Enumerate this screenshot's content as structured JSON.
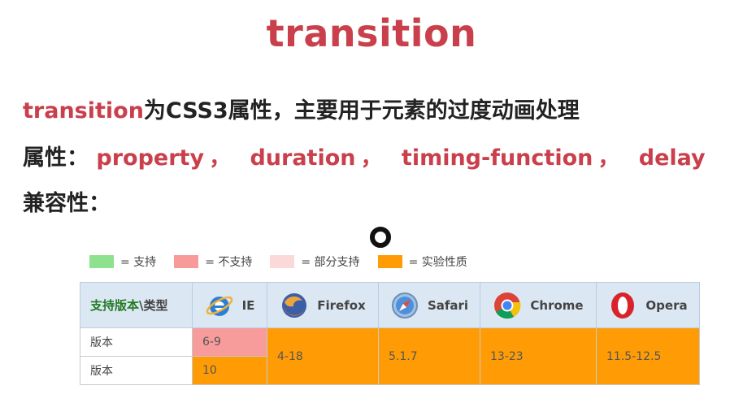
{
  "title": "transition",
  "line1": {
    "keyword": "transition",
    "rest": "为CSS3属性，主要用于元素的过度动画处理"
  },
  "line2": {
    "label": "属性：",
    "props": [
      "property",
      "duration",
      "timing-function",
      "delay"
    ],
    "separator": "，"
  },
  "line3": {
    "label": "兼容性："
  },
  "legend": [
    {
      "label": "= 支持",
      "color": "#8ee28e"
    },
    {
      "label": "= 不支持",
      "color": "#f69a9a"
    },
    {
      "label": "= 部分支持",
      "color": "#fbd9d9"
    },
    {
      "label": "= 实验性质",
      "color": "#ff9c05"
    }
  ],
  "table": {
    "corner": {
      "a": "支持版本",
      "sep": "\\",
      "b": "类型"
    },
    "browsers": [
      "IE",
      "Firefox",
      "Safari",
      "Chrome",
      "Opera"
    ],
    "row_labels": [
      "版本",
      "版本"
    ],
    "ie": [
      "6-9",
      "10"
    ],
    "others": [
      "4-18",
      "5.1.7",
      "13-23",
      "11.5-12.5"
    ]
  },
  "colors": {
    "accent": "#c9404c",
    "supported_partial": "#f79b9b",
    "experimental": "#ff9c05",
    "header_bg": "#dbe7f3"
  },
  "icons": [
    "ie-icon",
    "firefox-icon",
    "safari-icon",
    "chrome-icon",
    "opera-icon"
  ]
}
